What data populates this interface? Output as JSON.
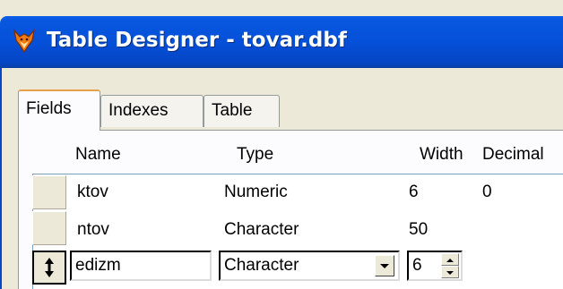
{
  "window": {
    "title": "Table Designer - tovar.dbf",
    "icon": "foxpro-fox-icon"
  },
  "tabs": [
    {
      "label": "Fields",
      "active": true
    },
    {
      "label": "Indexes",
      "active": false
    },
    {
      "label": "Table",
      "active": false
    }
  ],
  "columns": {
    "name": "Name",
    "type": "Type",
    "width": "Width",
    "decimal": "Decimal"
  },
  "rows": [
    {
      "name": "ktov",
      "type": "Numeric",
      "width": "6",
      "decimal": "0"
    },
    {
      "name": "ntov",
      "type": "Character",
      "width": "50",
      "decimal": ""
    },
    {
      "name": "edizm",
      "type": "Character",
      "width": "6",
      "decimal": ""
    }
  ],
  "colors": {
    "titlebar": "#0550d8",
    "tab_highlight": "#e5a24b",
    "face": "#ece9d8"
  }
}
